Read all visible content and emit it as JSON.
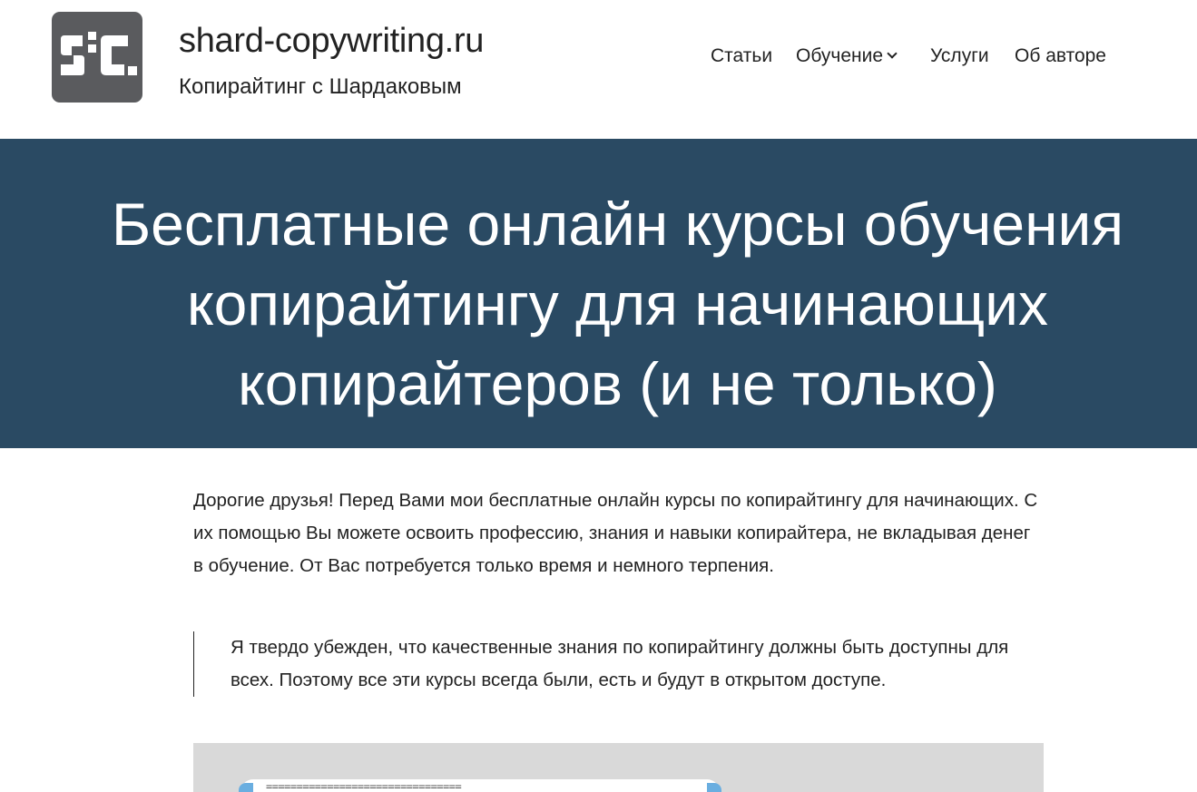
{
  "header": {
    "logo_alt": "SC",
    "site_title": "shard-copywriting.ru",
    "tagline": "Копирайтинг с Шардаковым"
  },
  "nav": {
    "items": [
      {
        "label": "Статьи"
      },
      {
        "label": "Обучение",
        "has_dropdown": true
      },
      {
        "label": "Услуги"
      },
      {
        "label": "Об авторе"
      }
    ]
  },
  "hero": {
    "title": "Бесплатные онлайн курсы обучения копирайтингу для начинающих копирайтеров (и не только)"
  },
  "content": {
    "intro": "Дорогие друзья! Перед Вами мои бесплатные онлайн курсы по копирайтингу для начинающих. С их помощью Вы можете освоить профессию, знания и навыки копирайтера, не вкладывая денег в обучение. От Вас потребуется только время и немного терпения.",
    "quote": "Я твердо убежден, что качественные знания по копирайтингу должны быть доступны для всех. Поэтому все эти курсы всегда были, есть и будут в открытом доступе."
  },
  "media": {
    "first_line": "================================"
  },
  "colors": {
    "hero_background": "#2a4a63",
    "logo_background": "#5a5b5e",
    "accent_blue": "#6aaee0",
    "media_background": "#d9d9d9"
  }
}
